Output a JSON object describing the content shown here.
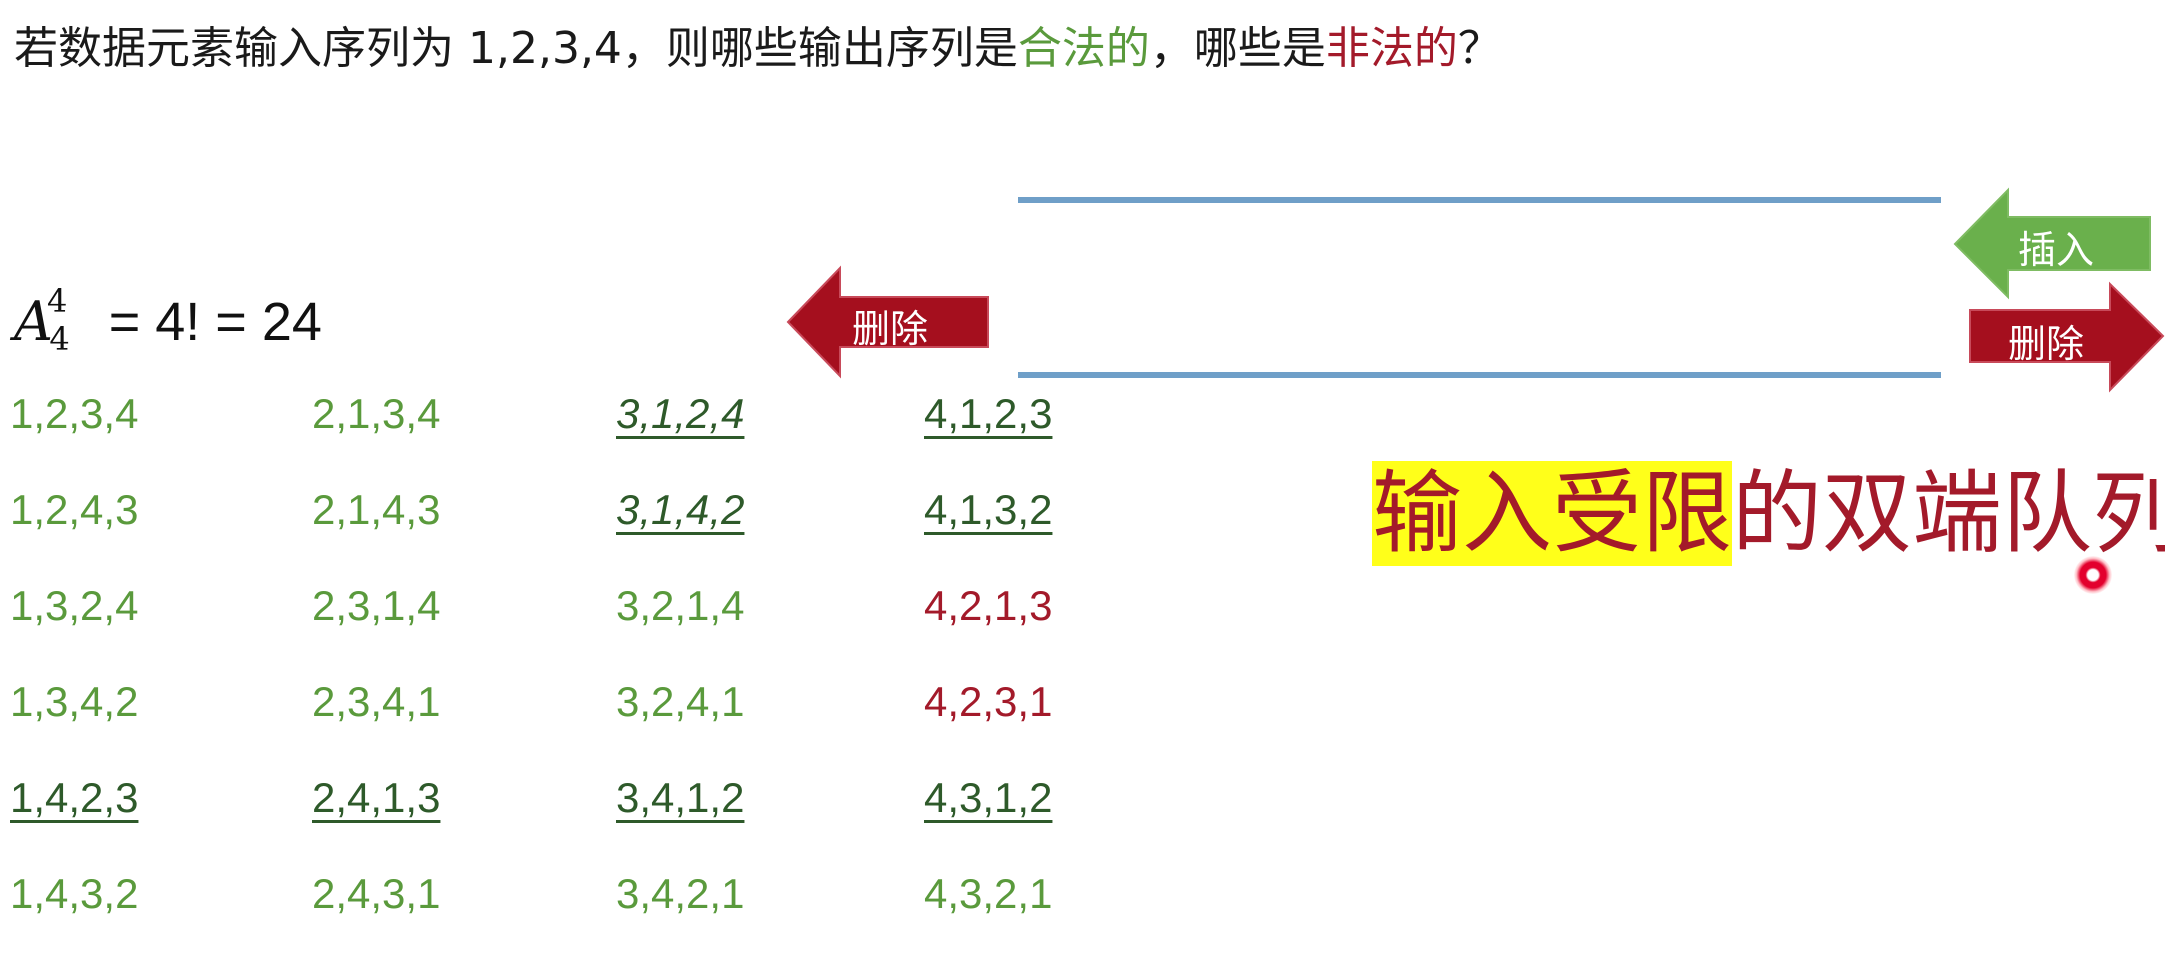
{
  "question": {
    "part1": "若数据元素输入序列为 1,2,3,4，则哪些输出序列是",
    "legal": "合法的",
    "part2": "，哪些是",
    "illegal": "非法的",
    "part3": "？"
  },
  "formula": {
    "symbol": "A",
    "sup": "4",
    "sub": "4",
    "rest": " = 4! = 24"
  },
  "queue": {
    "insert_label": "插入",
    "delete_right_label": "删除",
    "delete_left_label": "删除"
  },
  "title": {
    "highlight": "输入受限",
    "rest": "的双端队列"
  },
  "colors": {
    "legal": "#5a9a3c",
    "legal_underlined": "#2e5a2a",
    "illegal": "#a31a2a",
    "queue_line": "#6f9fc8",
    "delete_arrow": "#a50f1e",
    "insert_arrow": "#6ab04c",
    "highlight": "#ffff1a"
  },
  "sequences": {
    "columns": [
      [
        {
          "text": "1,2,3,4",
          "style": "green"
        },
        {
          "text": "1,2,4,3",
          "style": "green"
        },
        {
          "text": "1,3,2,4",
          "style": "green"
        },
        {
          "text": "1,3,4,2",
          "style": "green"
        },
        {
          "text": "1,4,2,3",
          "style": "dark"
        },
        {
          "text": "1,4,3,2",
          "style": "green"
        }
      ],
      [
        {
          "text": "2,1,3,4",
          "style": "green"
        },
        {
          "text": "2,1,4,3",
          "style": "green"
        },
        {
          "text": "2,3,1,4",
          "style": "green"
        },
        {
          "text": "2,3,4,1",
          "style": "green"
        },
        {
          "text": "2,4,1,3",
          "style": "dark"
        },
        {
          "text": "2,4,3,1",
          "style": "green"
        }
      ],
      [
        {
          "text": "3,1,2,4",
          "style": "dark italic"
        },
        {
          "text": "3,1,4,2",
          "style": "dark italic"
        },
        {
          "text": "3,2,1,4",
          "style": "green"
        },
        {
          "text": "3,2,4,1",
          "style": "green"
        },
        {
          "text": "3,4,1,2",
          "style": "dark"
        },
        {
          "text": "3,4,2,1",
          "style": "green"
        }
      ],
      [
        {
          "text": "4,1,2,3",
          "style": "dark"
        },
        {
          "text": "4,1,3,2",
          "style": "dark"
        },
        {
          "text": "4,2,1,3",
          "style": "red"
        },
        {
          "text": "4,2,3,1",
          "style": "red"
        },
        {
          "text": "4,3,1,2",
          "style": "dark"
        },
        {
          "text": "4,3,2,1",
          "style": "green"
        }
      ]
    ]
  }
}
